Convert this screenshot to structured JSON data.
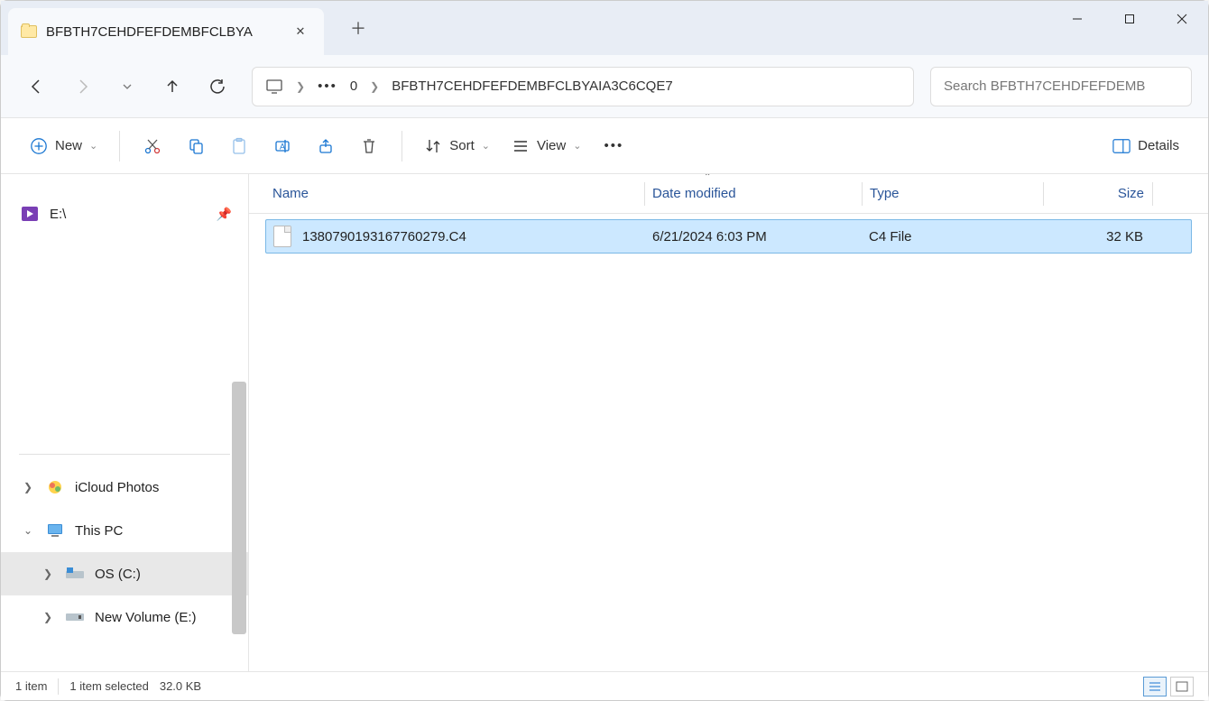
{
  "window": {
    "tab_title": "BFBTH7CEHDFEFDEMBFCLBYA",
    "minimize": "—",
    "maximize": "▢",
    "close": "✕"
  },
  "nav": {
    "back": "←",
    "forward": "→",
    "up": "↑",
    "refresh": "⟳"
  },
  "address": {
    "root": "0",
    "folder": "BFBTH7CEHDFEFDEMBFCLBYAIA3C6CQE7"
  },
  "search": {
    "placeholder": "Search BFBTH7CEHDFEFDEMB"
  },
  "toolbar": {
    "new": "New",
    "sort": "Sort",
    "view": "View",
    "details": "Details"
  },
  "columns": {
    "name": "Name",
    "date": "Date modified",
    "type": "Type",
    "size": "Size"
  },
  "files": [
    {
      "name": "1380790193167760279.C4",
      "date": "6/21/2024 6:03 PM",
      "type": "C4 File",
      "size": "32 KB"
    }
  ],
  "sidebar": {
    "drive_e": "E:\\",
    "icloud": "iCloud Photos",
    "this_pc": "This PC",
    "os_c": "OS (C:)",
    "new_vol": "New Volume (E:)"
  },
  "status": {
    "count": "1 item",
    "selected": "1 item selected",
    "size": "32.0 KB"
  }
}
